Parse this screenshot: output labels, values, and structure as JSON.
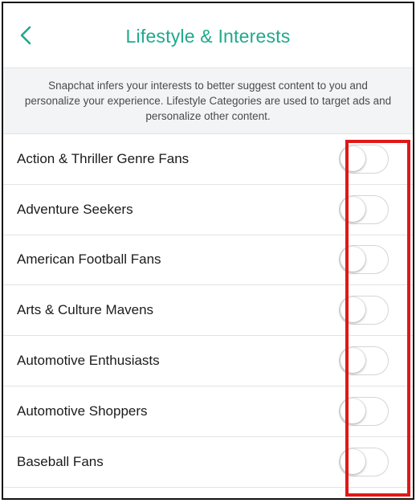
{
  "header": {
    "back_icon": "chevron-left-icon",
    "title": "Lifestyle & Interests"
  },
  "description": "Snapchat infers your interests to better suggest content to you and personalize your experience.  Lifestyle Categories are used to target ads and personalize other content.",
  "items": [
    {
      "label": "Action & Thriller Genre Fans",
      "enabled": false
    },
    {
      "label": "Adventure Seekers",
      "enabled": false
    },
    {
      "label": "American Football Fans",
      "enabled": false
    },
    {
      "label": "Arts & Culture Mavens",
      "enabled": false
    },
    {
      "label": "Automotive Enthusiasts",
      "enabled": false
    },
    {
      "label": "Automotive Shoppers",
      "enabled": false
    },
    {
      "label": "Baseball Fans",
      "enabled": false
    }
  ],
  "colors": {
    "accent": "#1fa98c",
    "highlight": "#e01818",
    "description_bg": "#f3f4f6"
  }
}
